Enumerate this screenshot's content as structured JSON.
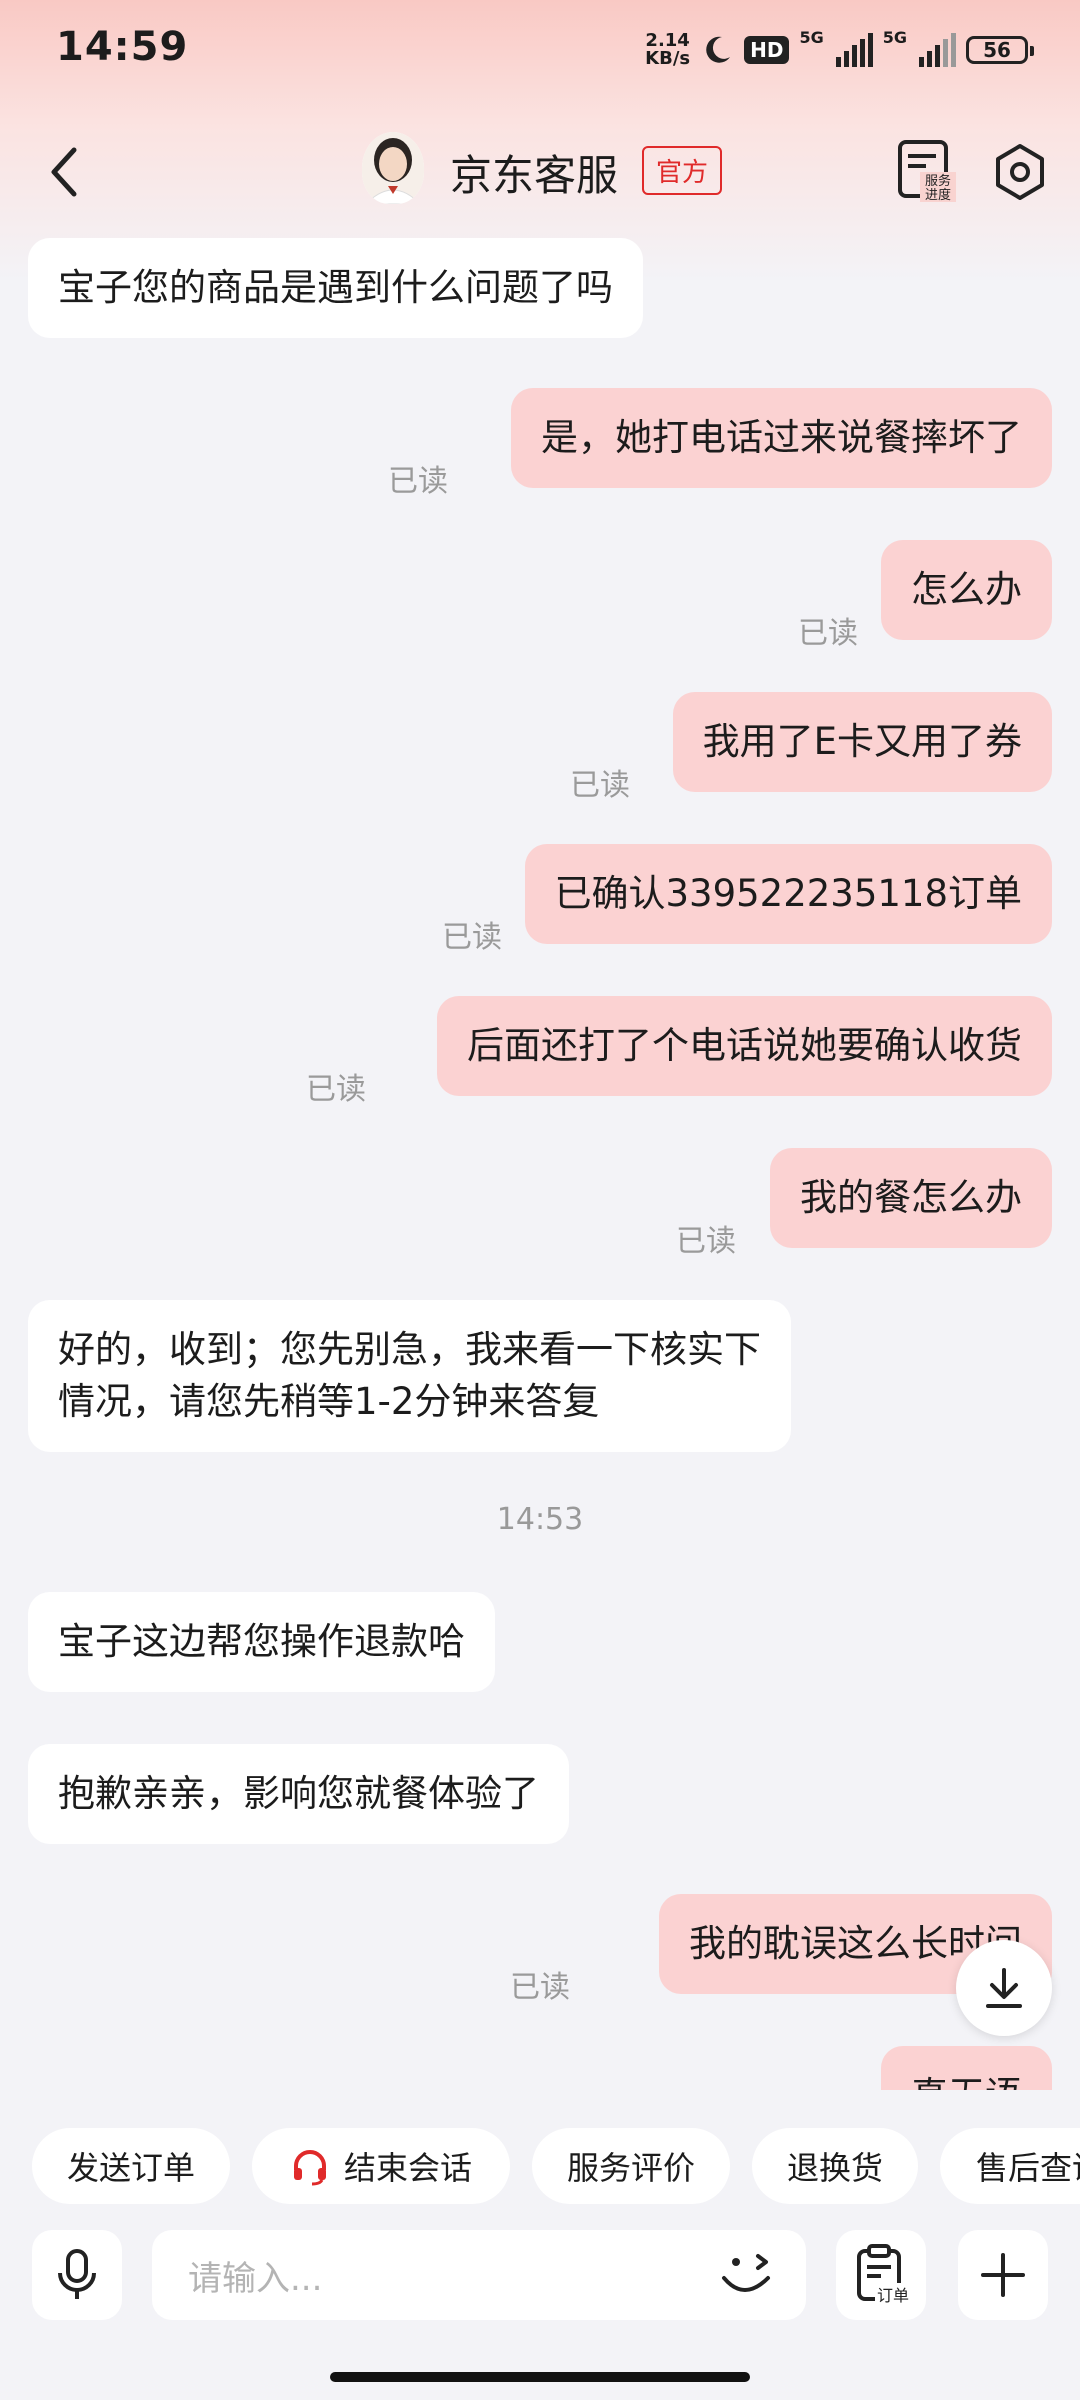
{
  "status_bar": {
    "time": "14:59",
    "net_speed": "2.14",
    "net_unit": "KB/s",
    "hd_label": "HD",
    "signal_label": "5G",
    "battery": "56"
  },
  "header": {
    "title": "京东客服",
    "badge": "官方",
    "service_line1": "服务",
    "service_line2": "进度"
  },
  "read_label": "已读",
  "messages": [
    {
      "from": "agent",
      "text": "宝子您的商品是遇到什么问题了吗"
    },
    {
      "from": "user",
      "text": "是，她打电话过来说餐摔坏了"
    },
    {
      "from": "user",
      "text": "怎么办"
    },
    {
      "from": "user",
      "text": "我用了E卡又用了券"
    },
    {
      "from": "user",
      "text": "已确认339522235118订单"
    },
    {
      "from": "user",
      "text": "后面还打了个电话说她要确认收货"
    },
    {
      "from": "user",
      "text": "我的餐怎么办"
    },
    {
      "from": "agent",
      "text": "好的，收到；您先别急，我来看一下核实下",
      "text2": "情况，请您先稍等1-2分钟来答复"
    },
    {
      "from": "agent",
      "text": "宝子这边帮您操作退款哈"
    },
    {
      "from": "agent",
      "text": "抱歉亲亲，影响您就餐体验了"
    },
    {
      "from": "user",
      "text": "我的耽误这么长时间"
    },
    {
      "from": "user",
      "text": "真无语"
    }
  ],
  "timestamp": "14:53",
  "quick_actions": [
    "发送订单",
    "结束会话",
    "服务评价",
    "退换货",
    "售后查询"
  ],
  "input": {
    "placeholder": "请输入..."
  },
  "order_button_label": "订单",
  "colors": {
    "accent": "#e02a2a",
    "user_bubble": "#fbd2d2",
    "agent_bubble": "#ffffff",
    "background": "#f3f3f7"
  }
}
